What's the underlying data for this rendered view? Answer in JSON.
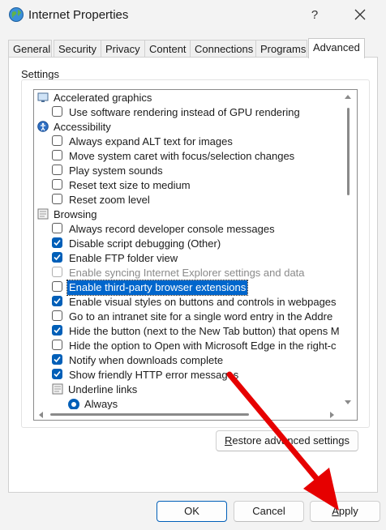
{
  "window": {
    "title": "Internet Properties",
    "help_label": "?"
  },
  "tabs": [
    {
      "label": "General"
    },
    {
      "label": "Security"
    },
    {
      "label": "Privacy"
    },
    {
      "label": "Content"
    },
    {
      "label": "Connections"
    },
    {
      "label": "Programs"
    },
    {
      "label": "Advanced",
      "active": true
    }
  ],
  "settings": {
    "group_label": "Settings",
    "rows": [
      {
        "type": "category",
        "label": "Accelerated graphics",
        "icon": "monitor-icon"
      },
      {
        "type": "checkbox",
        "label": "Use software rendering instead of GPU rendering",
        "checked": false
      },
      {
        "type": "category",
        "label": "Accessibility",
        "icon": "accessibility-icon"
      },
      {
        "type": "checkbox",
        "label": "Always expand ALT text for images",
        "checked": false
      },
      {
        "type": "checkbox",
        "label": "Move system caret with focus/selection changes",
        "checked": false
      },
      {
        "type": "checkbox",
        "label": "Play system sounds",
        "checked": false
      },
      {
        "type": "checkbox",
        "label": "Reset text size to medium",
        "checked": false
      },
      {
        "type": "checkbox",
        "label": "Reset zoom level",
        "checked": false
      },
      {
        "type": "category",
        "label": "Browsing",
        "icon": "document-icon"
      },
      {
        "type": "checkbox",
        "label": "Always record developer console messages",
        "checked": false
      },
      {
        "type": "checkbox",
        "label": "Disable script debugging (Other)",
        "checked": true
      },
      {
        "type": "checkbox",
        "label": "Enable FTP folder view",
        "checked": true
      },
      {
        "type": "checkbox",
        "label": "Enable syncing Internet Explorer settings and data",
        "checked": false,
        "disabled": true
      },
      {
        "type": "checkbox",
        "label": "Enable third-party browser extensions",
        "checked": false,
        "selected": true
      },
      {
        "type": "checkbox",
        "label": "Enable visual styles on buttons and controls in webpages",
        "checked": true
      },
      {
        "type": "checkbox",
        "label": "Go to an intranet site for a single word entry in the Addre",
        "checked": false
      },
      {
        "type": "checkbox",
        "label": "Hide the button (next to the New Tab button) that opens M",
        "checked": true
      },
      {
        "type": "checkbox",
        "label": "Hide the option to Open with Microsoft Edge in the right-c",
        "checked": false
      },
      {
        "type": "checkbox",
        "label": "Notify when downloads complete",
        "checked": true
      },
      {
        "type": "checkbox",
        "label": "Show friendly HTTP error messages",
        "checked": true
      },
      {
        "type": "subcategory",
        "label": "Underline links",
        "icon": "document-icon"
      },
      {
        "type": "radio",
        "label": "Always",
        "checked": true
      }
    ]
  },
  "buttons": {
    "restore": {
      "before": "",
      "underlined": "R",
      "after": "estore advanced settings"
    },
    "ok": "OK",
    "cancel": "Cancel",
    "apply": {
      "underlined": "A",
      "after": "pply"
    }
  },
  "colors": {
    "accent": "#005fb8",
    "selection": "#0066cc",
    "annotation_arrow": "#e60000"
  }
}
